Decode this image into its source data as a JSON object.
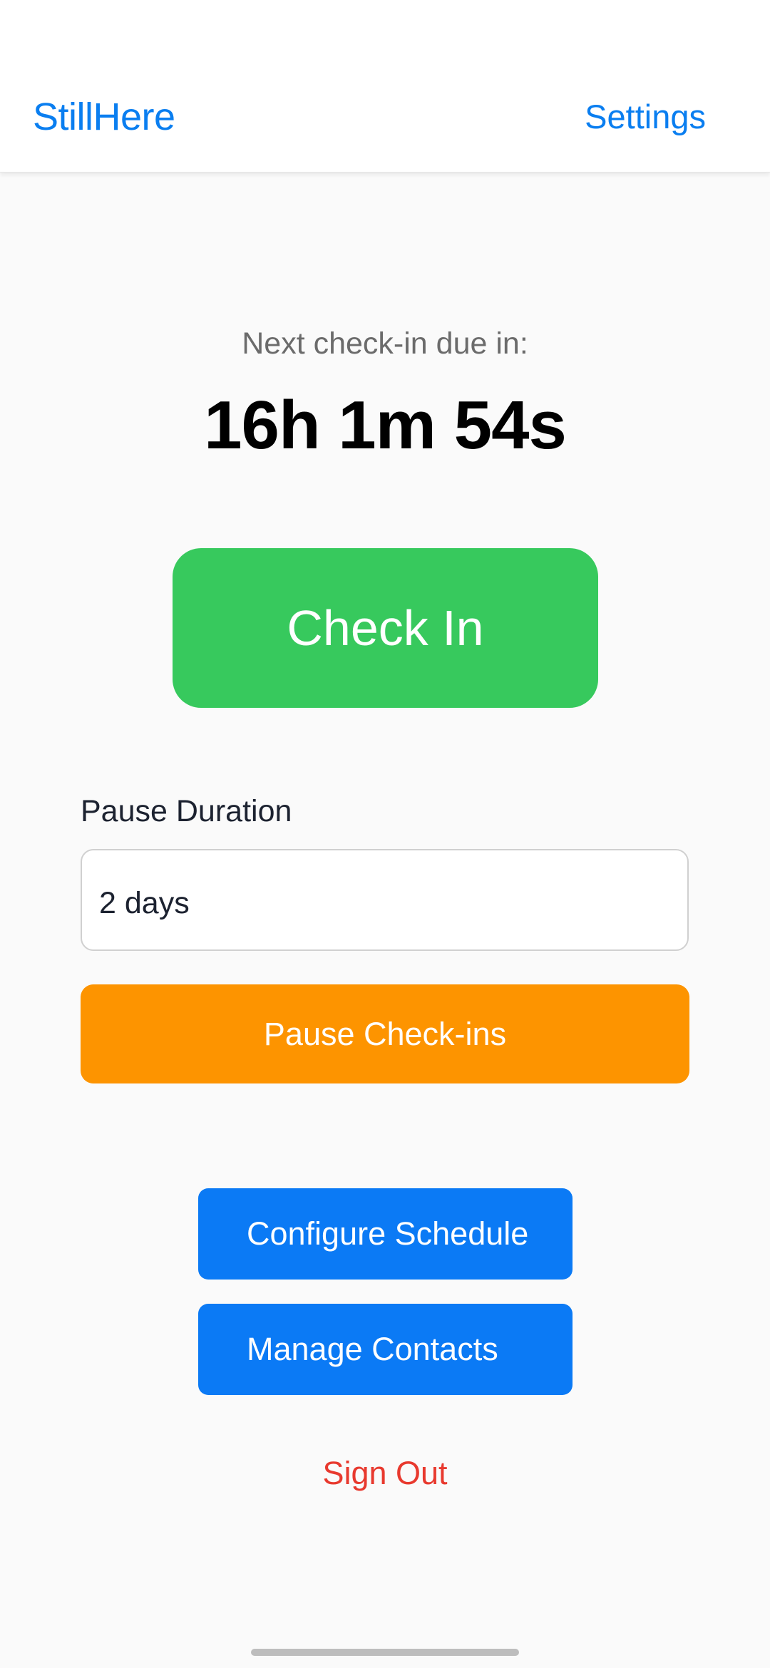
{
  "header": {
    "title": "StillHere",
    "settings_label": "Settings"
  },
  "checkin": {
    "next_label": "Next check-in due in:",
    "countdown": "16h 1m 54s",
    "button_label": "Check In"
  },
  "pause": {
    "label": "Pause Duration",
    "duration_value": "2 days",
    "button_label": "Pause Check-ins"
  },
  "actions": {
    "configure_label": "Configure Schedule",
    "contacts_label": "Manage Contacts",
    "signout_label": "Sign Out"
  },
  "colors": {
    "accent": "#0a7ef0",
    "checkin_green": "#37c95d",
    "pause_orange": "#fd9400",
    "button_blue": "#0b7af5",
    "signout_red": "#e8392e"
  }
}
